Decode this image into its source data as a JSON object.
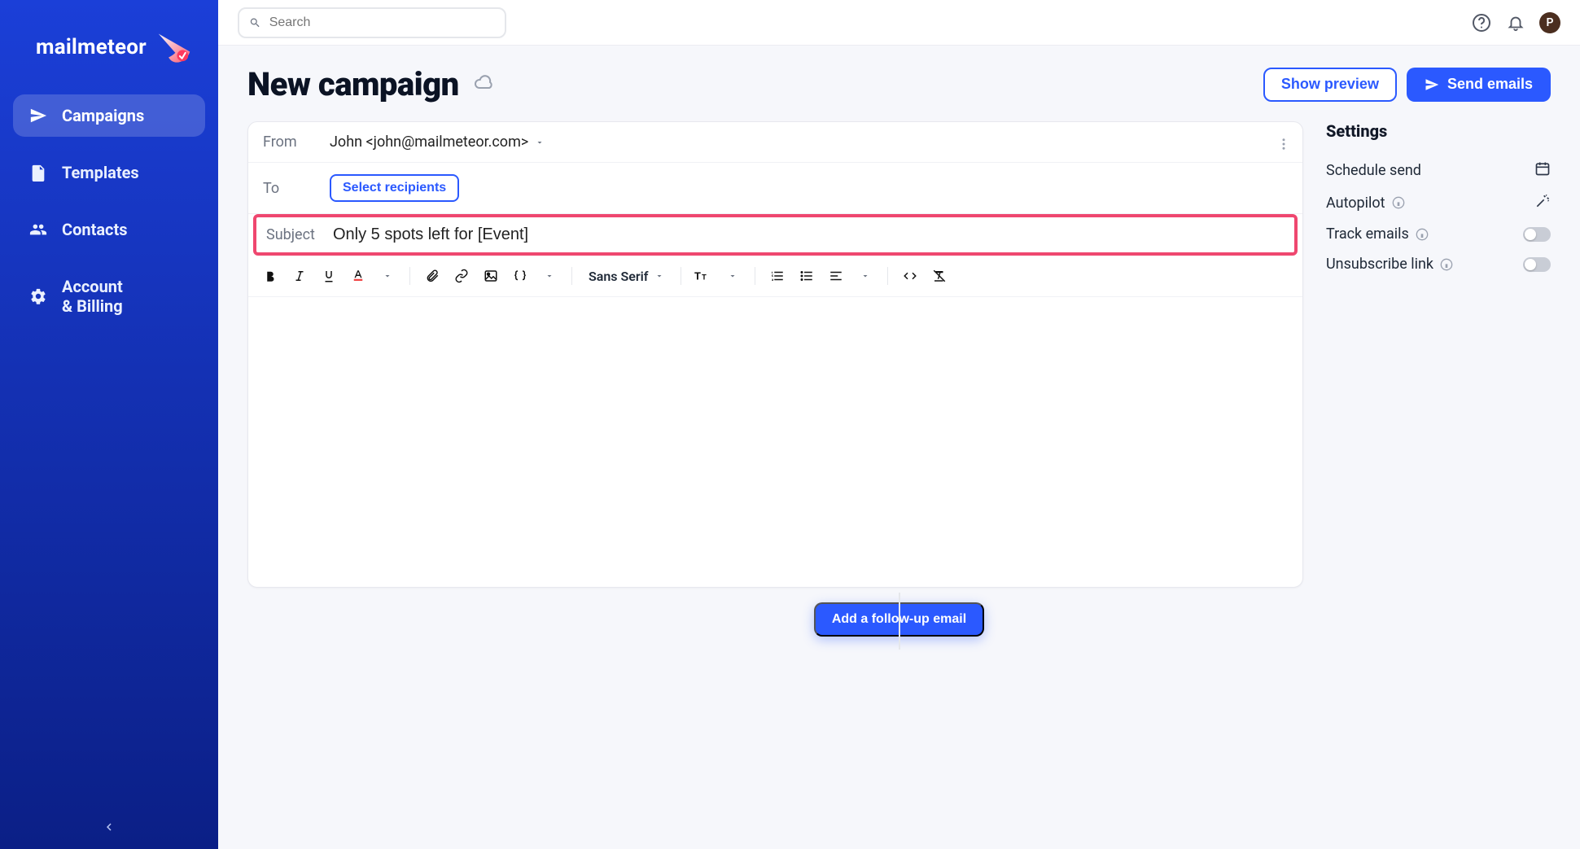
{
  "brand": {
    "name": "mailmeteor"
  },
  "sidebar": {
    "items": [
      {
        "icon": "send-icon",
        "label": "Campaigns",
        "active": true
      },
      {
        "icon": "document-icon",
        "label": "Templates",
        "active": false
      },
      {
        "icon": "people-icon",
        "label": "Contacts",
        "active": false
      },
      {
        "icon": "gear-icon",
        "label": "Account\n& Billing",
        "active": false
      }
    ]
  },
  "topbar": {
    "search_placeholder": "Search",
    "avatar_initial": "P"
  },
  "page": {
    "title": "New campaign"
  },
  "actions": {
    "show_preview": "Show preview",
    "send_emails": "Send emails"
  },
  "composer": {
    "labels": {
      "from": "From",
      "to": "To",
      "subject": "Subject"
    },
    "from_display": "John <john@mailmeteor.com>",
    "to_button": "Select recipients",
    "subject_value": "Only 5 spots left for [Event]",
    "font_name": "Sans Serif",
    "body": ""
  },
  "settings": {
    "title": "Settings",
    "items": [
      {
        "label": "Schedule send",
        "control": "calendar"
      },
      {
        "label": "Autopilot",
        "control": "wand",
        "info": true
      },
      {
        "label": "Track emails",
        "control": "toggle",
        "info": true,
        "on": false
      },
      {
        "label": "Unsubscribe link",
        "control": "toggle",
        "info": true,
        "on": false
      }
    ]
  },
  "followup": {
    "label": "Add a follow-up email"
  },
  "colors": {
    "primary": "#2b59ff",
    "highlight": "#ef476f",
    "sidebar_top": "#1b3fd8",
    "sidebar_bottom": "#0b1f86"
  }
}
